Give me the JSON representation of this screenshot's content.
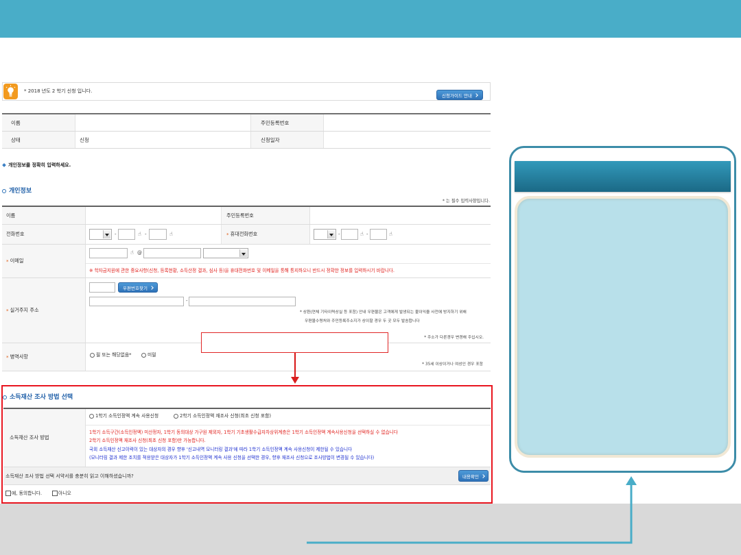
{
  "colors": {
    "accent": "#49adc8",
    "highlight_red": "#e8141e",
    "button_blue": "#3a82c4",
    "title_blue": "#1f5fa8",
    "notice_red": "#e0201c",
    "notice_blue": "#1d2fd0",
    "panel_border": "#3c8ca8",
    "panel_fill": "#b8e0ea",
    "footer_gray": "#d9d9d9"
  },
  "notice": {
    "icon": "lightbulb-icon",
    "text": "* 2018 년도 2 학기 신청 입니다.",
    "guide_button": "신청가이드 안내"
  },
  "summary": {
    "name_label": "이름",
    "rrn_label": "주민등록번호",
    "status_label": "상태",
    "status_value": "신청",
    "date_label": "신청일자"
  },
  "instruction": {
    "bullet_icon": "diamond-icon",
    "text": "개인정보를 정확히 입력하세요."
  },
  "personal": {
    "title": "개인정보",
    "required_note": "* 는 필수 입력사항입니다.",
    "required_mark": "*",
    "name_label": "이름",
    "rrn_label": "주민등록번호",
    "phone_label": "전화번호",
    "mobile_label": "휴대전화번호",
    "separator": "-",
    "secure_input_icon": "hand-pointer-icon",
    "email_label": "이메일",
    "email_at": "@",
    "email_notice": "※ 학자금지원에 관한 중요사항(신청, 등록현황, 소득산정 결과, 심사 등)을 휴대전화번호 및 이메일을 통해 통지하오니 반드시 정확한 정보를 입력하시기 바랍니다.",
    "address_label": "실거주지 주소",
    "zip_button": "우편번호찾기",
    "address_notes": [
      "* 상환(연체 기타이력상실 등 포함) 안내 우편물은 고객에게 발생되는 불이익을 사전에 방지하기 위해",
      "우편물수령처와 주민등록주소지가 상이할 경우 두 곳 모두 발송합니다"
    ],
    "address_change_note": "* 주소가 다른경우 변경해 주십시오.",
    "military_label": "병역사항",
    "military_options": [
      "필 또는 해당없음*",
      "미필"
    ],
    "military_note": "* 35세 이상이거나 여성인 경우 포함"
  },
  "income": {
    "title": "소득재산 조사 방법 선택",
    "method_label": "소득재산 조사 방법",
    "options": [
      "1학기 소득인정액 계속 사용신청",
      "2학기 소득인정액 재조사 신청(최초 신청 포함)"
    ],
    "red_notes": [
      "1학기 소득구간(소득인정액) 미산정자, 1학기 동의대상 가구원 제외자, 1학기 기초생활수급자차상위계층은 1학기 소득인정액 계속사용신청을 선택하실 수 없습니다",
      "2학기 소득인정액 재조사 신청(최초 신청 포함)만 가능합니다."
    ],
    "blue_notes": [
      "국외 소득재산 신고이력이 있는 대상자의 경우 향후 '신고내역 모니터링 결과'에 따라 1학기 소득인정액 계속 사용신청이 제한될 수 있습니다",
      "(모니터링 결과 제한 조치를 적용받은 대상자가 1학기 소득인정액 계속 사용 신청을 선택한 경우, 향후 재조사 신청으로 조사방법이 변경될 수 있습니다)"
    ],
    "agreement_question": "소득재산 조사 방법 선택 서약서를 충분히 읽고 이해하셨습니까?",
    "confirm_button": "내용확인",
    "agree_options": [
      "예, 동의합니다.",
      "아니오"
    ]
  }
}
